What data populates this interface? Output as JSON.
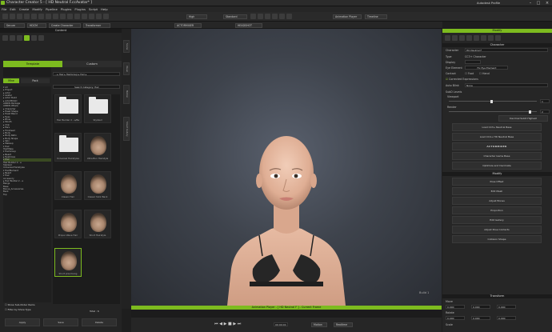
{
  "window": {
    "title": "Character Creator 5 - [ HD Neutral F.ccAvatar* ]",
    "account": "Autodesk Profile"
  },
  "menu": [
    "File",
    "Edit",
    "Create",
    "Modify",
    "Pipeline",
    "Plugins",
    "Plugins",
    "Script",
    "Help"
  ],
  "toolbar": {
    "quality": "High",
    "shading": "Standard",
    "animation_player": "Animation Player",
    "timeline": "Timeline"
  },
  "toolbar2": {
    "secure": "Secure",
    "hdcm": "HDCM",
    "create_character": "Create Character",
    "transformer": "Transformer",
    "actor_mixer": "ACTORMIXER",
    "headshot": "HEADSHOT"
  },
  "content": {
    "header": "Content",
    "tab_template": "Template",
    "tab_custom": "Custom",
    "subtab_mine": "Mine",
    "subtab_pack": "Pack",
    "path": "... ▸ Hair ▸ HairGroup ▸ Hair ▸",
    "search": "Search Category: Hair",
    "tree": [
      "▾ All",
      "  ▸ Project",
      "  ▸ Actor",
      "  ▾ Avatar",
      "    ▸ Actor Build",
      "    ▸ ActorBUILD",
      "      ARKOS Package",
      "      ARKOS Where",
      "    ▸ Character",
      "    ▸ Head Shape",
      "    ▸ Head Blend",
      "    ▸ Eyes",
      "    ▸ Brow",
      "    ▸ Mouth",
      "    ▸ Chin",
      "    ▸ Ears",
      "    ▸ Forehead",
      "    ▸ Body",
      "    ▸ Body Ratio",
      "    ▸ Body Shape",
      "  ▸ Skin",
      "  ▸ Makeup",
      "  ▾ Hair",
      "      HairMake",
      "    ▾ HairGroup",
      "      ▸ Beard",
      "      ▸ Eyebrows",
      "      ▾ Hair",
      "          Hair Builder 2 - e",
      "          Stylized",
      "          Universal Hairstyles",
      "    ▾ HairElement",
      "      ▸ Beard",
      "      ▾ Hair",
      "          Accessory",
      "        ▸ Hair Builder 2 - e",
      "          Bangs",
      "          Base",
      "          Bonus_Accessories",
      "          Back",
      "          Top"
    ],
    "thumbs": [
      "Hair Builder 2 - e/Be",
      "Stylized",
      "Universal Hairstyles",
      "Ultra Bun Hairstyle",
      "Classic Hair",
      "Classic Slick Back",
      "Proper Wave Hair",
      "Short Hairstyle",
      "Short pixel bang"
    ],
    "show_sub": "Show Sub-folder Items",
    "filter": "Filter by Show Type",
    "total": "Total : 6",
    "footer": [
      "Apply",
      "Save",
      "Delete"
    ]
  },
  "side_tabs": [
    "Scene",
    "Visual",
    "Motion",
    "Smart Gallery"
  ],
  "viewport": {
    "overlay": "Bulld 1"
  },
  "timeline": {
    "header": "Animation Player - [ HD Neutral F ] - Current Frame",
    "motion": "Motion",
    "realtime": "Realtime",
    "time": "00:00:00"
  },
  "modify": {
    "header": "Modify",
    "section_character": "Character",
    "character_label": "Character",
    "character_value": "HD Neutral F",
    "type_label": "Type",
    "type_value": "CC3+ Character",
    "display_label": "Display",
    "eye_label": "Eye Element",
    "eye_value": "Fix Eye Element",
    "contact_label": "Contact",
    "contact_opt1": "Foot",
    "contact_opt2": "Hand",
    "correct": "Corrected Expressions",
    "autoblink_label": "Auto Blink",
    "autoblink_value": "None",
    "subd_label": "SubD Levels",
    "viewport_label": "Viewport",
    "viewport_value": "1",
    "render_label": "Render",
    "render_value": "2",
    "subd_button": "Decimal SubD Highest",
    "buttons": [
      "Load CC3+ Neutral Base",
      "Load CC4+ HD Neutral Base",
      "ACTORMIXER",
      "Character Game Base",
      "Optimize and Decimate"
    ],
    "section_modify": "Modify",
    "modify_buttons": [
      "Pose Offset",
      "Edit Mesh",
      "Adjust Bones",
      "Proportion",
      "Edit Gallery",
      "Adjust Pose Contacts",
      "Collision Shape"
    ],
    "section_transform": "Transform",
    "move_label": "Move",
    "move": [
      "0.000",
      "0.000",
      "0.000"
    ],
    "rotate_label": "Rotate",
    "rotate": [
      "0.000",
      "0.000",
      "0.000"
    ],
    "scale_label": "Scale",
    "colors": {
      "accent": "#7dbb1f"
    }
  }
}
